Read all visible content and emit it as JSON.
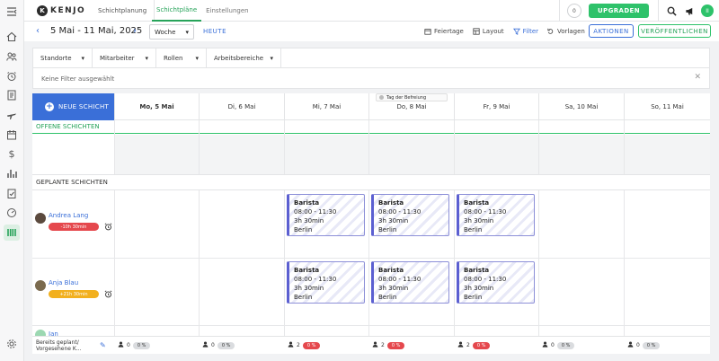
{
  "app": {
    "logo_mark": "K",
    "logo_text": "KENJO",
    "main_nav": "Schichtplanung",
    "tabs": [
      "Schichtpläne",
      "Einstellungen"
    ],
    "notif_count": "0",
    "upgrade_label": "UPGRADEN",
    "user_initials": "II"
  },
  "toolbar": {
    "date_range": "5 Mai - 11 Mai, 2025",
    "view_select": "Woche",
    "today_label": "HEUTE",
    "holidays_label": "Feiertage",
    "layout_label": "Layout",
    "filter_label": "Filter",
    "templates_label": "Vorlagen",
    "actions_label": "AKTIONEN",
    "publish_label": "VERÖFFENTLICHEN"
  },
  "filters": {
    "dropdowns": [
      "Standorte",
      "Mitarbeiter",
      "Rollen",
      "Arbeitsbereiche"
    ],
    "none_selected": "Keine Filter ausgewählt",
    "close": "✕"
  },
  "schedule": {
    "new_shift_label": "NEUE SCHICHT",
    "days": [
      "Mo, 5 Mai",
      "Di, 6 Mai",
      "Mi, 7 Mai",
      "Do, 8 Mai",
      "Fr, 9 Mai",
      "Sa, 10 Mai",
      "So, 11 Mai"
    ],
    "holiday_label": "Tag der Befreiung",
    "open_shifts_label": "OFFENE SCHICHTEN",
    "planned_shifts_label": "GEPLANTE SCHICHTEN",
    "employees": [
      {
        "name": "Andrea Lang",
        "hours_badge": "-10h 30min",
        "badge_color": "#e5484d",
        "shifts": [
          {
            "day": 2,
            "role": "Barista",
            "time": "08:00 - 11:30",
            "duration": "3h 30min",
            "location": "Berlin"
          },
          {
            "day": 3,
            "role": "Barista",
            "time": "08:00 - 11:30",
            "duration": "3h 30min",
            "location": "Berlin"
          },
          {
            "day": 4,
            "role": "Barista",
            "time": "08:00 - 11:30",
            "duration": "3h 30min",
            "location": "Berlin"
          }
        ]
      },
      {
        "name": "Anja Blau",
        "hours_badge": "+21h 30min",
        "badge_color": "#f2b01e",
        "shifts": [
          {
            "day": 2,
            "role": "Barista",
            "time": "08:00 - 11:30",
            "duration": "3h 30min",
            "location": "Berlin"
          },
          {
            "day": 3,
            "role": "Barista",
            "time": "08:00 - 11:30",
            "duration": "3h 30min",
            "location": "Berlin"
          },
          {
            "day": 4,
            "role": "Barista",
            "time": "08:00 - 11:30",
            "duration": "3h 30min",
            "location": "Berlin"
          }
        ]
      },
      {
        "name": "Jan",
        "hours_badge": "",
        "badge_color": "#2ec26a",
        "shifts": []
      }
    ],
    "footer": {
      "label": "Bereits geplant/ Vorgesehene K...",
      "cells": [
        {
          "count": "0",
          "percent": "0 %",
          "alert": false
        },
        {
          "count": "0",
          "percent": "0 %",
          "alert": false
        },
        {
          "count": "2",
          "percent": "0 %",
          "alert": true
        },
        {
          "count": "2",
          "percent": "0 %",
          "alert": true
        },
        {
          "count": "2",
          "percent": "0 %",
          "alert": true
        },
        {
          "count": "0",
          "percent": "0 %",
          "alert": false
        },
        {
          "count": "0",
          "percent": "0 %",
          "alert": false
        }
      ]
    }
  }
}
